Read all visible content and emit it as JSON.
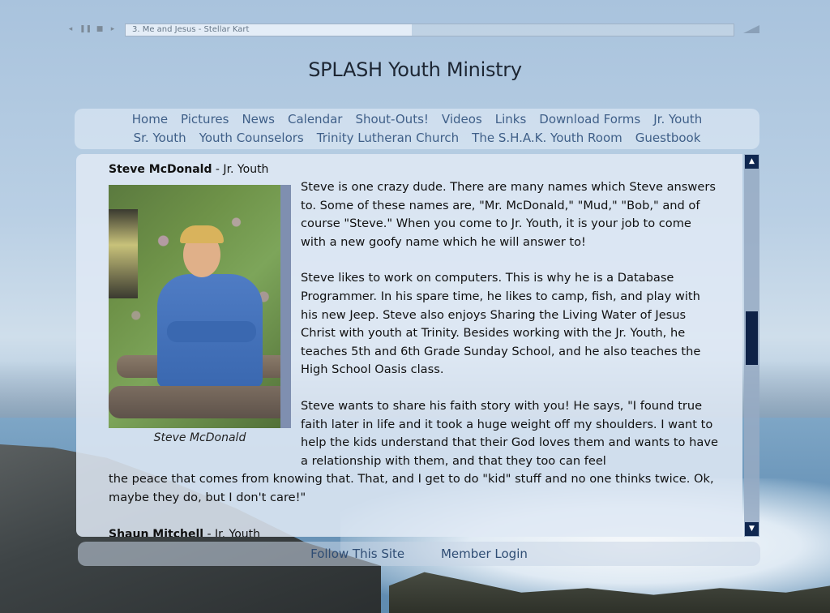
{
  "player": {
    "track_title": "3. Me and Jesus - Stellar Kart",
    "progress": 0.47,
    "icons": [
      "volume-icon",
      "pause-icon",
      "stop-icon",
      "next-icon"
    ]
  },
  "site": {
    "title": "SPLASH Youth Ministry"
  },
  "nav": {
    "row1": [
      "Home",
      "Pictures",
      "News",
      "Calendar",
      "Shout-Outs!",
      "Videos",
      "Links",
      "Download Forms",
      "Jr. Youth"
    ],
    "row2": [
      "Sr. Youth",
      "Youth Counselors",
      "Trinity Lutheran Church",
      "The S.H.A.K. Youth Room",
      "Guestbook"
    ]
  },
  "content": {
    "person_name": "Steve McDonald",
    "person_group": " - Jr. Youth",
    "photo_caption": "Steve McDonald",
    "paragraphs": [
      "Steve is one crazy dude.  There are many names which Steve answers to.  Some of these names are, \"Mr. McDonald,\" \"Mud,\" \"Bob,\" and of course \"Steve.\"  When you come to Jr. Youth, it is your job to come with a new goofy name which he will answer to!",
      "Steve likes to work on computers.  This is why he is a Database Programmer.  In his spare time, he likes to camp, fish, and play with his new Jeep.  Steve also enjoys Sharing the Living Water of Jesus Christ with youth at Trinity.  Besides working with the Jr. Youth, he teaches 5th and 6th Grade Sunday School, and he also teaches the High School Oasis class.",
      "Steve wants to share his faith story with you!  He says, \"I found true faith later in life and it took a huge weight off my shoulders.  I want to help the kids understand that their God loves them and wants to have a relationship with them, and that they too can feel",
      "the peace that comes from knowing that.  That, and I get to do \"kid\" stuff and no one thinks twice.  Ok, maybe they do, but I don't care!\""
    ],
    "next_person_name": "Shaun Mitchell",
    "next_person_group": " - Jr. Youth"
  },
  "footer": {
    "follow": "Follow This Site",
    "login": "Member Login"
  },
  "colors": {
    "nav_link": "#3f5f88",
    "scroll_thumb": "#0e2247"
  }
}
